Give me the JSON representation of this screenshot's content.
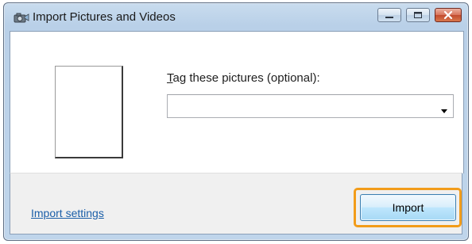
{
  "window": {
    "title": "Import Pictures and Videos",
    "app_icon": "camera-import-icon",
    "caption_buttons": {
      "minimize_icon": "minimize-icon",
      "maximize_icon": "maximize-icon",
      "close_icon": "close-icon"
    }
  },
  "main": {
    "tag_label_access_key": "T",
    "tag_label_rest": "ag these pictures (optional):",
    "tag_combo_value": "",
    "tag_combo_arrow_icon": "chevron-down-icon"
  },
  "footer": {
    "settings_link": "Import settings",
    "import_button": "Import",
    "focus_highlight_color": "#f29c1a"
  }
}
